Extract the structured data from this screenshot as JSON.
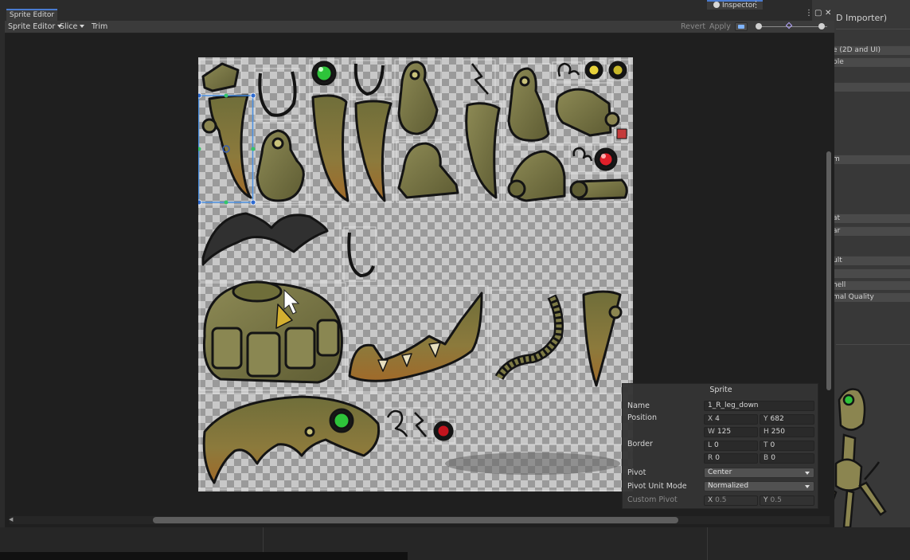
{
  "window": {
    "tab_title": "Sprite Editor"
  },
  "toolbar": {
    "sprite_editor_menu": "Sprite Editor",
    "slice_menu": "Slice",
    "trim_button": "Trim",
    "revert_button": "Revert",
    "apply_button": "Apply",
    "window_menu_glyph": "⋮",
    "maximize_glyph": "▢",
    "close_glyph": "✕"
  },
  "inspector": {
    "tab_title": "Inspector",
    "menu_glyph": "⋮",
    "header_fragment": "D Importer)",
    "fields": [
      "e (2D and UI)",
      "ple",
      "",
      "",
      "m",
      "",
      "at",
      "ar",
      "",
      "ult",
      "",
      "hell",
      "mal Quality"
    ]
  },
  "sprite_panel": {
    "title": "Sprite",
    "name_label": "Name",
    "name_value": "1_R_leg_down",
    "position_label": "Position",
    "x_label": "X",
    "x_value": "4",
    "y_label": "Y",
    "y_value": "682",
    "w_label": "W",
    "w_value": "125",
    "h_label": "H",
    "h_value": "250",
    "border_label": "Border",
    "l_label": "L",
    "l_value": "0",
    "t_label": "T",
    "t_value": "0",
    "r_label": "R",
    "r_value": "0",
    "b_label": "B",
    "b_value": "0",
    "pivot_label": "Pivot",
    "pivot_value": "Center",
    "pivot_unit_label": "Pivot Unit Mode",
    "pivot_unit_value": "Normalized",
    "custom_pivot_label": "Custom Pivot",
    "cx_label": "X",
    "cx_value": "0.5",
    "cy_label": "Y",
    "cy_value": "0.5"
  },
  "colors": {
    "accent": "#4a7bd0",
    "selection": "#4a90e2",
    "pivot_handle": "#35c46a",
    "sprite_olive": "#7d7a45",
    "sprite_outline": "#141414",
    "gem_green": "#2ec43a",
    "gem_red": "#e0202a",
    "gem_yellow": "#e8d23a"
  }
}
